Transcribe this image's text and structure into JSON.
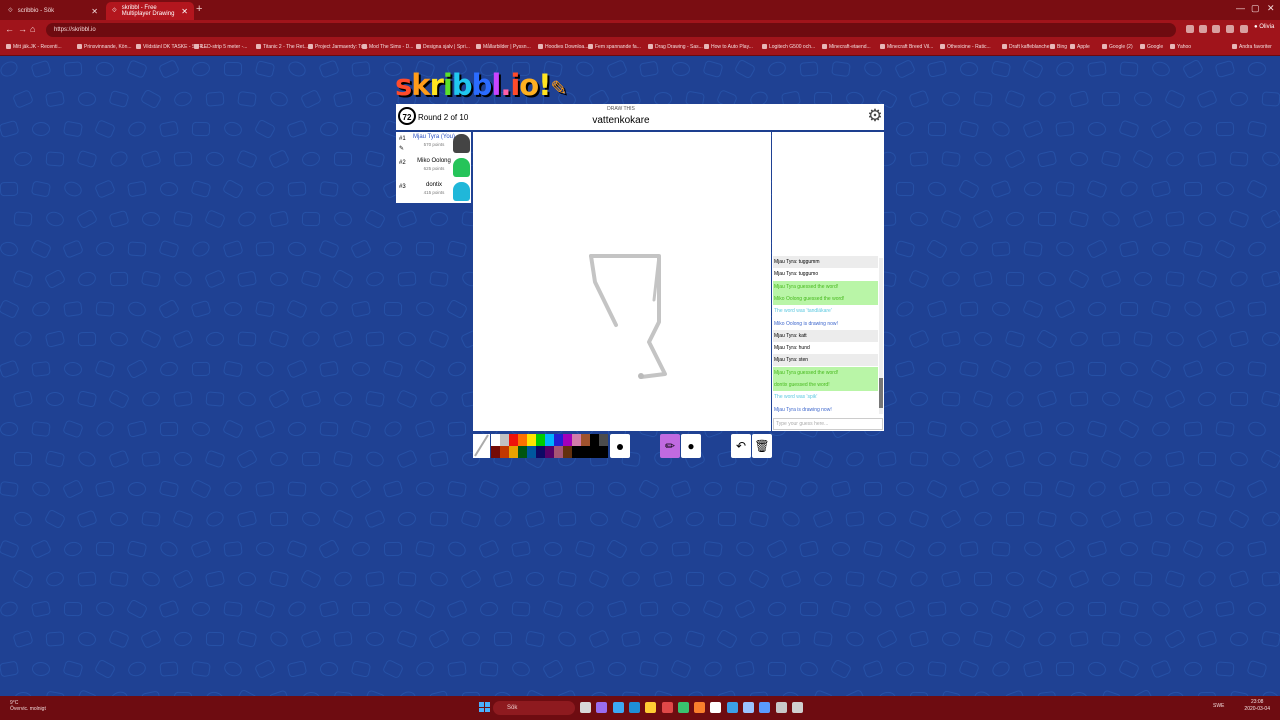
{
  "browser": {
    "tabs": [
      {
        "label": "scribbio - Sök"
      },
      {
        "label": "skribbl - Free Multiplayer Drawing"
      }
    ],
    "new_tab": "+",
    "url": "https://skribbl.io",
    "window_controls": [
      "—",
      "▢",
      "✕"
    ],
    "nav": [
      "←",
      "→",
      "⟳",
      "⌂"
    ],
    "profile": "Olivia",
    "bookmarks": [
      "Mitt jäk.JK - Recenti...",
      "Prinsvinnande, Kön...",
      "Vildstänl DK TASKE - SIFR...",
      "LED-strip 5 meter -...",
      "Titanic 2 - The Ret...",
      "Project Jarmaerdy: To...",
      "Mod The Sims - D...",
      "Designa sjalv | Spri...",
      "Mållarbilder | Pyssn...",
      "Hoodies Downloa...",
      "Fem spannande fa...",
      "Drag Drawing - Sas...",
      "How to Auto Play...",
      "Logitech G500 och...",
      "Minecraft-etaend...",
      "Minecraft Breed Vil...",
      "Othexicine - Ratic...",
      "Draft kaffeblanche...",
      "Bing",
      "Apple",
      "Google (2)",
      "Google",
      "Yahoo",
      "Andra favoriter"
    ]
  },
  "game": {
    "timer": "72",
    "round": "Round 2 of 10",
    "draw_this": "DRAW THIS",
    "word": "vattenkokare",
    "players": [
      {
        "rank": "#1",
        "name": "Mjau Tyra (You)",
        "points": "570 points",
        "color": "#2b52c4",
        "avatar": "#444"
      },
      {
        "rank": "#2",
        "name": "Miko Oolong",
        "points": "625 points",
        "color": "#000",
        "avatar": "#26c45a"
      },
      {
        "rank": "#3",
        "name": "dontix",
        "points": "415 points",
        "color": "#000",
        "avatar": "#20b7d9"
      }
    ],
    "chat": [
      {
        "text": "Mjau Tyra: tuggumm",
        "type": "msg"
      },
      {
        "text": "Mjau Tyra: tuggumo",
        "type": "msg"
      },
      {
        "text": "Mjau Tyra guessed the word!",
        "type": "guess"
      },
      {
        "text": "Miko Oolong guessed the word!",
        "type": "guess"
      },
      {
        "text": "The word was 'tandläkare'",
        "type": "reveal"
      },
      {
        "text": "Miko Oolong is drawing now!",
        "type": "draw"
      },
      {
        "text": "Mjau Tyra: katt",
        "type": "msg"
      },
      {
        "text": "Mjau Tyra: hund",
        "type": "msg"
      },
      {
        "text": "Mjau Tyra: sten",
        "type": "msg"
      },
      {
        "text": "Mjau Tyra guessed the word!",
        "type": "guess"
      },
      {
        "text": "dontix guessed the word!",
        "type": "guess"
      },
      {
        "text": "The word was 'spik'",
        "type": "reveal"
      },
      {
        "text": "Mjau Tyra is drawing now!",
        "type": "draw"
      }
    ],
    "guess_placeholder": "Type your guess here...",
    "palette": [
      "#ffffff",
      "#c1c1c1",
      "#ef130b",
      "#ff7100",
      "#ffe400",
      "#00cc00",
      "#00b2ff",
      "#231fd3",
      "#a300ba",
      "#d37caa",
      "#a0522d",
      "#000000",
      "#4c4c4c",
      "#740b07",
      "#c23800",
      "#e8a200",
      "#005510",
      "#00569e",
      "#0e0865",
      "#550069",
      "#a75574",
      "#63300d",
      "#000000",
      "#000000",
      "#000000",
      "#000000"
    ],
    "colors": {
      "canvas": "#ffffff",
      "stroke": "#c4c4c4",
      "accent": "#1d3f8f",
      "guess_bg": "#b9f5a7",
      "guess_text": "#46b91c",
      "reveal_text": "#5ac8e0",
      "draw_text": "#3c66cc"
    },
    "tools": {
      "pencil": "✏",
      "fill": "●",
      "undo": "↶",
      "clear": "🗑"
    }
  },
  "taskbar": {
    "weather": "9°C",
    "weather_desc": "Övervic. molnigt",
    "search": "Sök",
    "lang": "SWE",
    "time": "23:08",
    "date": "2020-03-04"
  }
}
